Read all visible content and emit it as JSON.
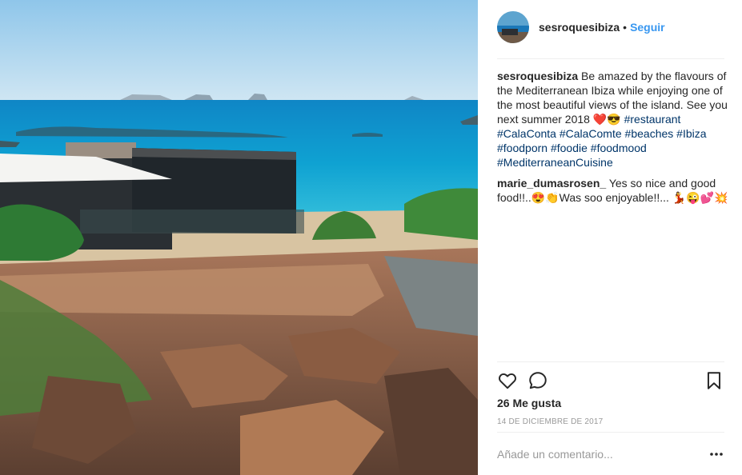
{
  "post": {
    "username": "sesroquesibiza",
    "separator": "•",
    "follow_label": "Seguir",
    "likes_label": "26 Me gusta",
    "date_label": "14 DE DICIEMBRE DE 2017",
    "add_comment_placeholder": "Añade un comentario..."
  },
  "caption": {
    "user": "sesroquesibiza",
    "text": "Be amazed by the flavours of the Mediterranean Ibiza while enjoying one of the most beautiful views of the island. See you next summer 2018 ❤️😎",
    "tags": [
      "#restaurant",
      "#CalaConta",
      "#CalaComte",
      "#beaches",
      "#Ibiza",
      "#foodporn",
      "#foodie",
      "#foodmood",
      "#MediterraneanCuisine"
    ]
  },
  "comment": {
    "user": "marie_dumasrosen_",
    "text": "Yes so nice and good food!!..😍👏Was soo enjoyable!!... 💃😜💕💥"
  },
  "icons": {
    "like": "heart-outline-icon",
    "comment": "speech-bubble-icon",
    "save": "bookmark-icon",
    "more": "ellipsis-icon"
  },
  "colors": {
    "link": "#3897f0",
    "hashtag": "#003569",
    "muted": "#999999",
    "text": "#262626"
  }
}
